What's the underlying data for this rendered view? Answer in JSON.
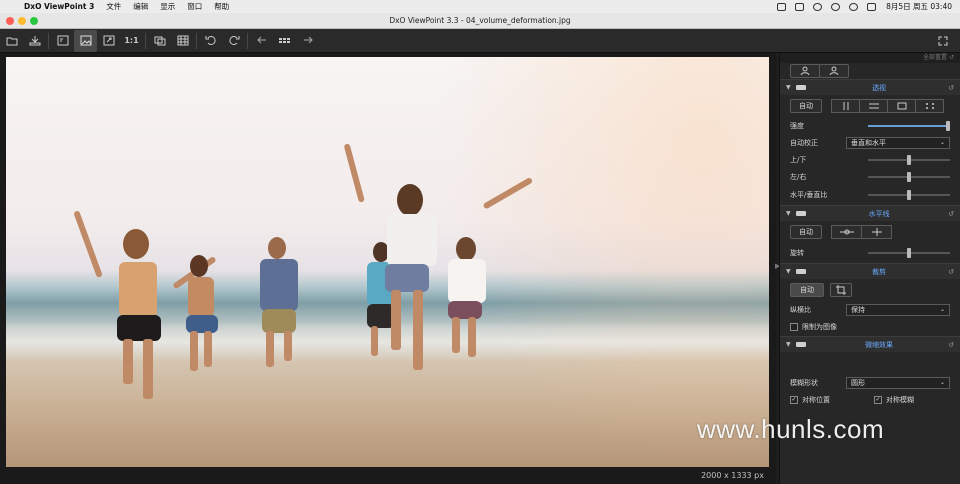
{
  "menubar": {
    "app_name": "DxO ViewPoint 3",
    "menus": [
      "文件",
      "编辑",
      "显示",
      "窗口",
      "帮助"
    ],
    "clock": "8月5日 周五 03:40"
  },
  "window": {
    "title": "DxO ViewPoint 3.3 - 04_volume_deformation.jpg"
  },
  "toolbar": {
    "zoom_label": "1:1",
    "icons": [
      "folder-icon",
      "export-icon",
      "before-after-icon",
      "image-view-icon",
      "fit-icon",
      "zoom-1-1",
      "compare-icon",
      "grid-icon",
      "rotate-left-icon",
      "rotate-right-icon",
      "back-icon",
      "filmstrip-icon",
      "forward-icon"
    ]
  },
  "viewer": {
    "dimensions": "2000 x 1333 px"
  },
  "panel": {
    "reset_all": "全部重置",
    "perspective": {
      "title": "透视",
      "auto_label": "自动",
      "intensity_label": "强度",
      "intensity_value": 1.0,
      "auto_correct_label": "自动校正",
      "auto_correct_value": "垂直和水平",
      "up_down_label": "上/下",
      "up_down_value": 0.5,
      "left_right_label": "左/右",
      "left_right_value": 0.5,
      "ratio_label": "水平/垂直比",
      "ratio_value": 0.5
    },
    "horizon": {
      "title": "水平线",
      "auto_label": "自动",
      "rotation_label": "旋转",
      "rotation_value": 0.5
    },
    "crop": {
      "title": "裁剪",
      "auto_label": "自动",
      "aspect_label": "纵横比",
      "aspect_value": "保持",
      "restrict_label": "限制为图像"
    },
    "miniature": {
      "title": "微缩效果",
      "blur_shape_label": "模糊形状",
      "blur_shape_value": "圆形",
      "sym_position_label": "对称位置",
      "sym_blur_label": "对称模糊"
    }
  },
  "watermark": "www.hunls.com"
}
